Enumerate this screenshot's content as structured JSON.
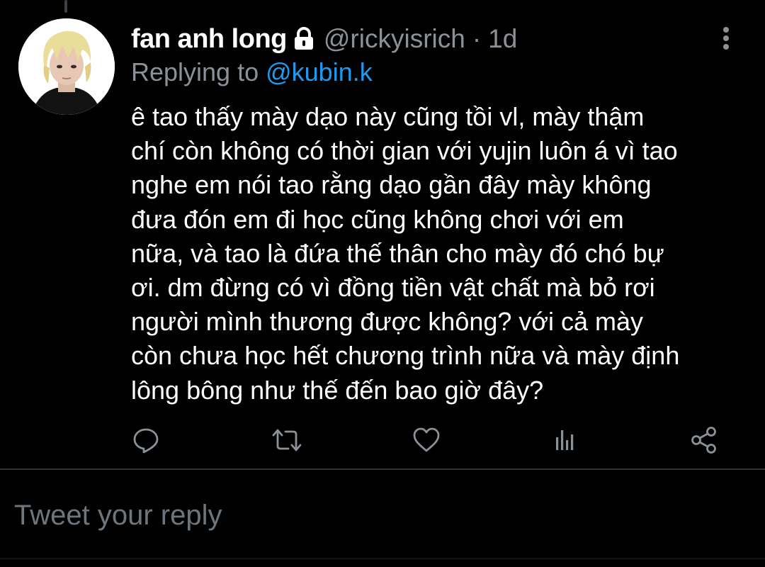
{
  "tweet": {
    "author": {
      "display_name": "fan anh long",
      "handle": "@rickyisrich",
      "avatar_icon": "avatar-photo-blonde-hair",
      "protected_icon": "lock-icon"
    },
    "separator": "·",
    "time": "1d",
    "replying_to": {
      "label": "Replying to",
      "mention": "@kubin.k"
    },
    "text_lines": [
      "ê tao thấy mày dạo này cũng tồi vl, mày thậm",
      "chí còn không có thời gian với yujin luôn á vì tao",
      "nghe em nói tao rằng dạo gần đây mày không",
      "đưa đón em đi học cũng không chơi với em",
      "nữa, và tao là đứa thế thân cho mày đó chó bự",
      "ơi. dm đừng có vì đồng tiền vật chất mà bỏ rơi",
      "người mình thương được không? với cả mày",
      "còn chưa học hết chương trình nữa và mày định",
      "lông bông như thế đến bao giờ đây?"
    ],
    "actions": [
      "reply-icon",
      "retweet-icon",
      "like-icon",
      "analytics-icon",
      "share-icon"
    ],
    "more_icon": "more-vertical-icon"
  },
  "reply_box": {
    "placeholder": "Tweet your reply",
    "value": ""
  },
  "colors": {
    "background": "#000000",
    "text": "#ffffff",
    "secondary": "#8b9197",
    "accent": "#1d9bf0",
    "divider": "#2f3336"
  }
}
